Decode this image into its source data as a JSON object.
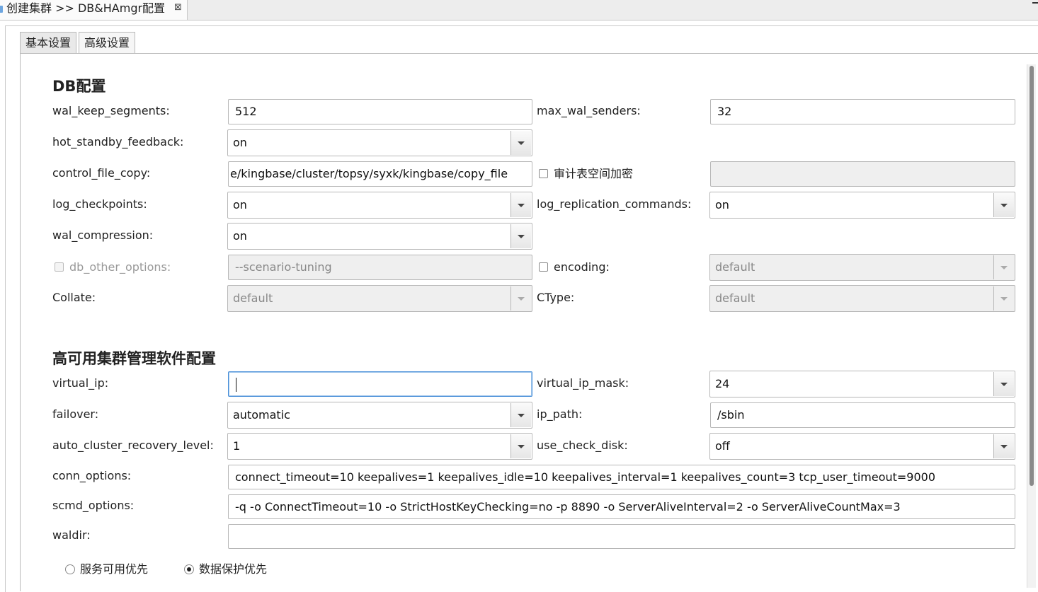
{
  "editor_tab": {
    "title": "创建集群 >> DB&HAmgr配置",
    "close_glyph": "⊠"
  },
  "tabs": {
    "basic": "基本设置",
    "advanced": "高级设置"
  },
  "db_section": {
    "title": "DB配置",
    "wal_keep_segments": {
      "label": "wal_keep_segments:",
      "value": "512"
    },
    "max_wal_senders": {
      "label": "max_wal_senders:",
      "value": "32"
    },
    "hot_standby_feedback": {
      "label": "hot_standby_feedback:",
      "value": "on"
    },
    "control_file_copy": {
      "label": "control_file_copy:",
      "value": "e/kingbase/cluster/topsy/syxk/kingbase/copy_file"
    },
    "audit_encrypt": {
      "label": "审计表空间加密",
      "checked": false,
      "value": ""
    },
    "log_checkpoints": {
      "label": "log_checkpoints:",
      "value": "on"
    },
    "log_replication_commands": {
      "label": "log_replication_commands:",
      "value": "on"
    },
    "wal_compression": {
      "label": "wal_compression:",
      "value": "on"
    },
    "db_other_options": {
      "label": "db_other_options:",
      "value": "--scenario-tuning",
      "checked": false
    },
    "encoding": {
      "label": "encoding:",
      "value": "default",
      "checked": false
    },
    "collate": {
      "label": "Collate:",
      "value": "default"
    },
    "ctype": {
      "label": "CType:",
      "value": "default"
    }
  },
  "ha_section": {
    "title": "高可用集群管理软件配置",
    "virtual_ip": {
      "label": "virtual_ip:",
      "value": ""
    },
    "virtual_ip_mask": {
      "label": "virtual_ip_mask:",
      "value": "24"
    },
    "failover": {
      "label": "failover:",
      "value": "automatic"
    },
    "ip_path": {
      "label": "ip_path:",
      "value": "/sbin"
    },
    "auto_cluster_recovery_level": {
      "label": "auto_cluster_recovery_level:",
      "value": "1"
    },
    "use_check_disk": {
      "label": "use_check_disk:",
      "value": "off"
    },
    "conn_options": {
      "label": "conn_options:",
      "value": "connect_timeout=10 keepalives=1 keepalives_idle=10 keepalives_interval=1 keepalives_count=3 tcp_user_timeout=9000"
    },
    "scmd_options": {
      "label": "scmd_options:",
      "value": "-q -o ConnectTimeout=10 -o StrictHostKeyChecking=no -p 8890 -o ServerAliveInterval=2 -o ServerAliveCountMax=3"
    },
    "waldir": {
      "label": "waldir:",
      "value": ""
    }
  },
  "priority": {
    "service": {
      "label": "服务可用优先",
      "checked": false
    },
    "data": {
      "label": "数据保护优先",
      "checked": true
    }
  }
}
